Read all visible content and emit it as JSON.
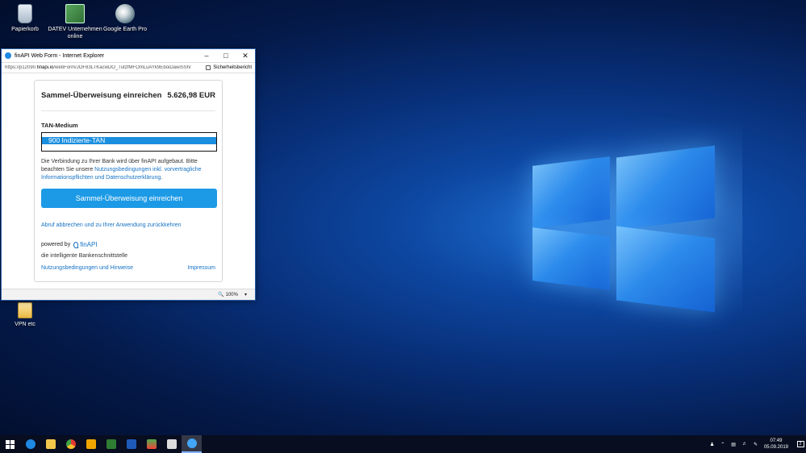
{
  "desktop": {
    "icons": [
      {
        "label": "Papierkorb"
      },
      {
        "label": "DATEV Unternehmen online"
      },
      {
        "label": "Google Earth Pro"
      },
      {
        "label": "VPN etc"
      }
    ]
  },
  "window": {
    "title": "finAPI Web Form - Internet Explorer",
    "url_prefix": "https://p12090.",
    "url_domain": "finapi.io",
    "url_rest": "/webForm/JOF83LTKacwDO_TutzfMFOmLuAYk9EboiDawiSSh/",
    "security_report": "Sicherheitsbericht",
    "zoom": "100%"
  },
  "form": {
    "heading": "Sammel-Überweisung einreichen",
    "amount": "5.626,98 EUR",
    "tan_label": "TAN-Medium",
    "tan_selected": "900 Indizierte-TAN",
    "note_part1": "Die Verbindung zu Ihrer Bank wird über finAPI aufgebaut. Bitte beachten Sie unsere ",
    "note_link": "Nutzungsbedingungen inkl. vorvertragliche Informationspflichten und Datenschutzerklärung",
    "note_part2": ".",
    "submit_label": "Sammel-Überweisung einreichen",
    "abort_link": "Abruf abbrechen und zu Ihrer Anwendung zurückkehren",
    "powered_by": "powered by",
    "brand": "finAPI",
    "tagline": "die intelligente Bankenschnittstelle",
    "terms_link": "Nutzungsbedingungen und Hinweise",
    "imprint_link": "Impressum"
  },
  "taskbar": {
    "time": "07:49",
    "date": "05.09.2019",
    "notifications": "2"
  },
  "colors": {
    "accent": "#1c9ae6",
    "link": "#1572c4"
  }
}
